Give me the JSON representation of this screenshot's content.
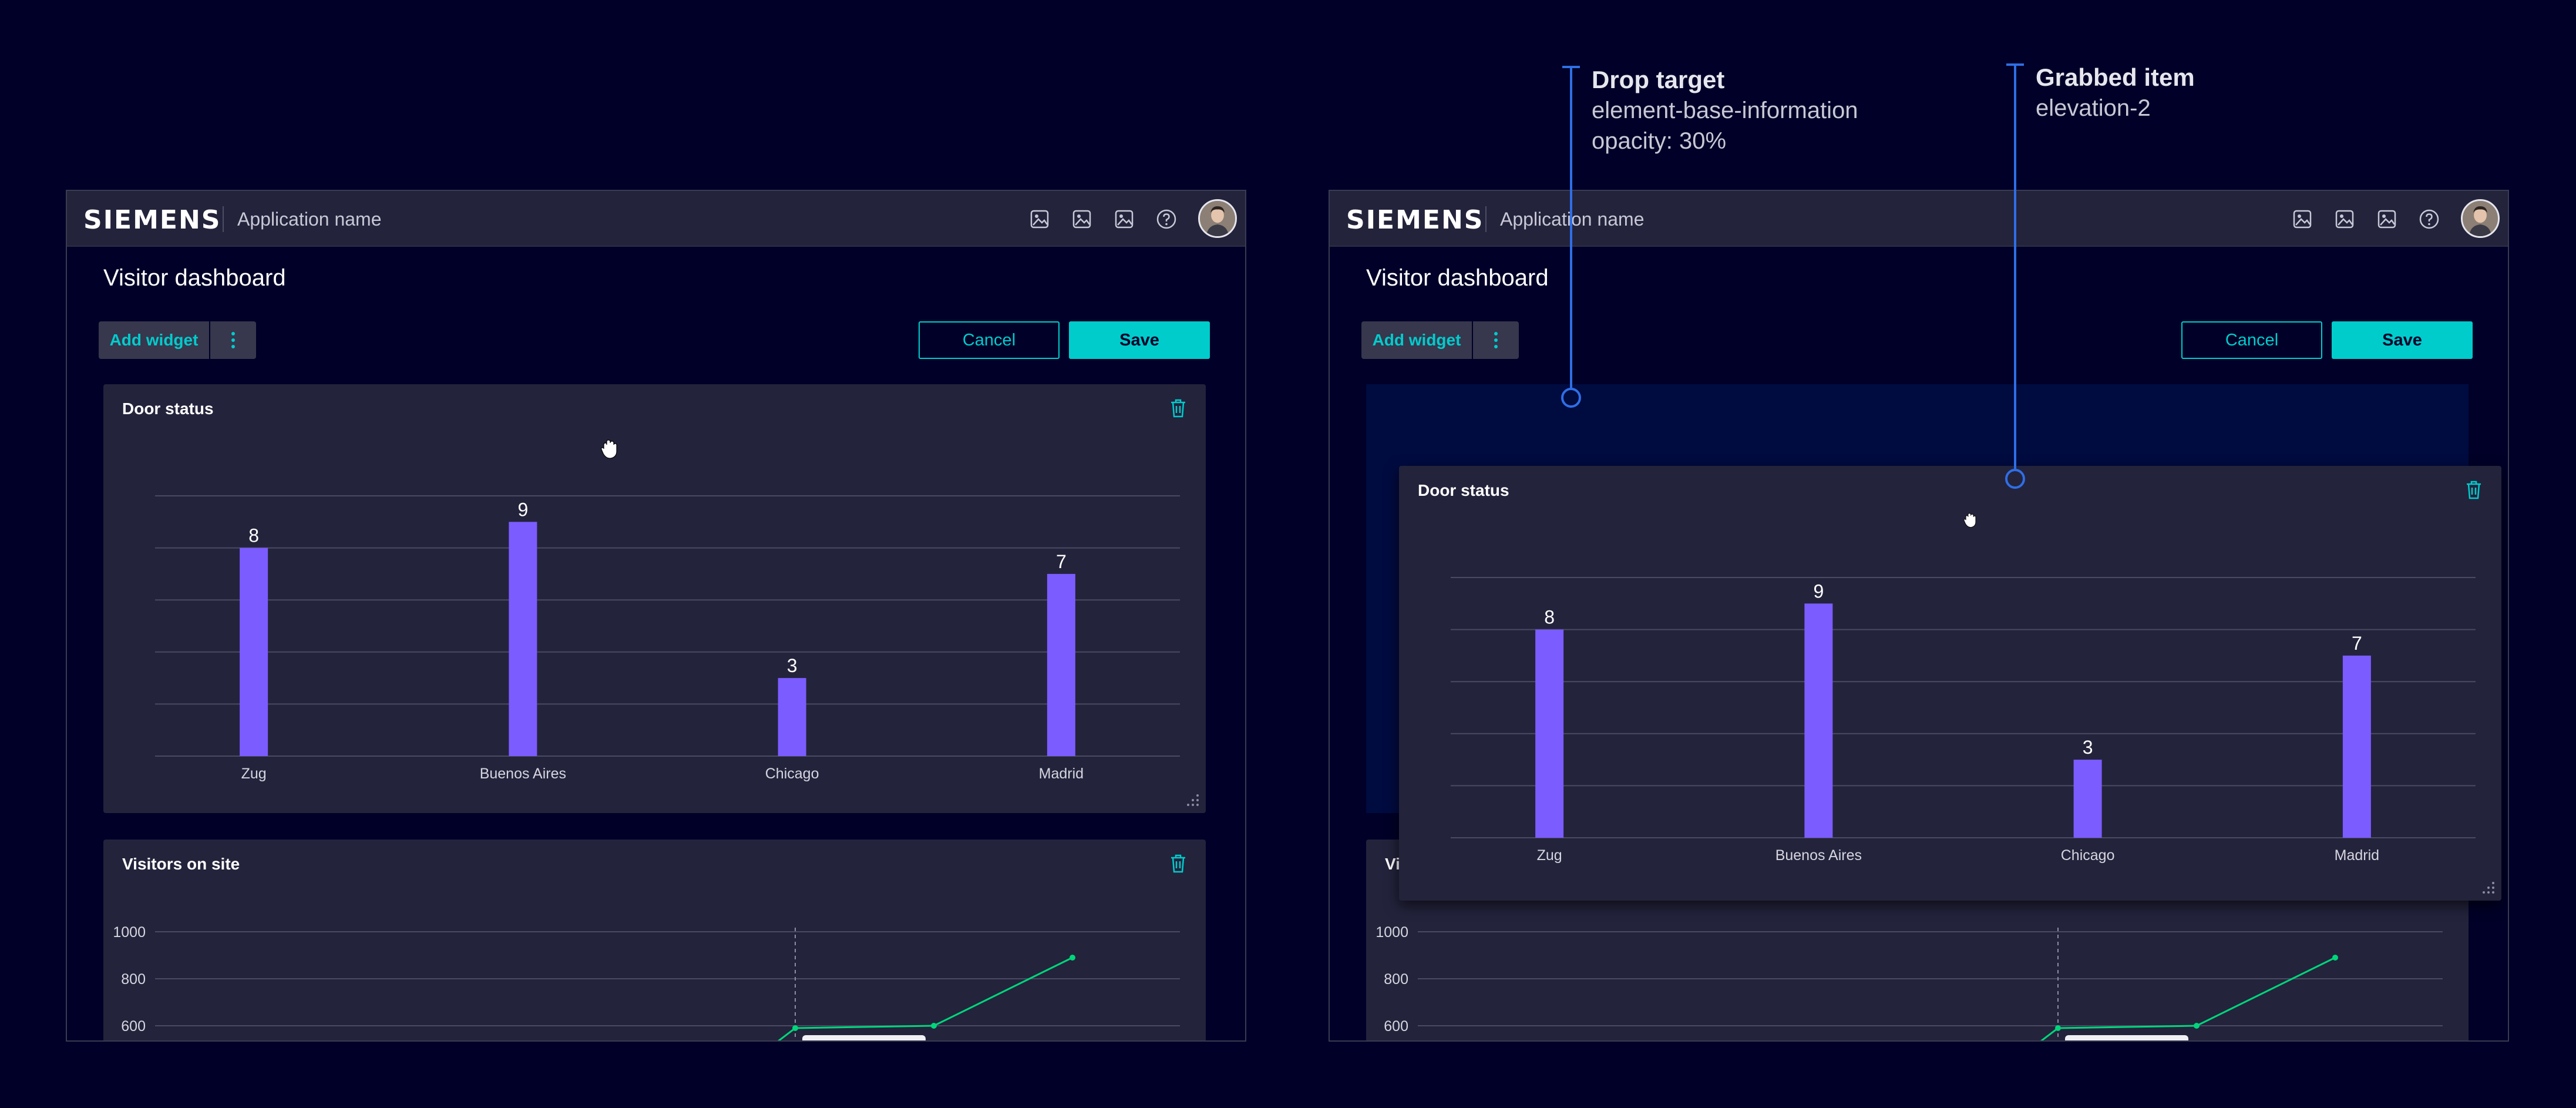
{
  "colors": {
    "background": "#000028",
    "panel": "#23233c",
    "accent": "#00cccc",
    "bar": "#7b5cff",
    "line": "#00d67a",
    "annotation_line": "#2f6ee6",
    "drop_target": "#00237a"
  },
  "annotations": {
    "drop_target": {
      "title": "Drop target",
      "line1": "element-base-information",
      "line2": "opacity: 30%"
    },
    "grabbed_item": {
      "title": "Grabbed item",
      "line1": "elevation-2"
    }
  },
  "header": {
    "logo": "SIEMENS",
    "app_name": "Application name",
    "icons": [
      "image-icon",
      "image-icon",
      "image-icon",
      "help-icon"
    ],
    "avatar": "user-avatar"
  },
  "page": {
    "title": "Visitor dashboard",
    "add_widget": "Add widget",
    "more_icon": "kebab-menu-icon",
    "cancel": "Cancel",
    "save": "Save"
  },
  "door_widget": {
    "title": "Door status",
    "delete_icon": "trash-icon",
    "cursor_icon": "grab-hand-icon",
    "resize_icon": "resize-handle-icon"
  },
  "visitors_widget": {
    "title": "Visitors on site",
    "title_truncated": "Vi",
    "delete_icon": "trash-icon"
  },
  "chart_data": [
    {
      "type": "bar",
      "title": "Door status",
      "categories": [
        "Zug",
        "Buenos Aires",
        "Chicago",
        "Madrid"
      ],
      "values": [
        8,
        9,
        3,
        7
      ],
      "data_labels": [
        "8",
        "9",
        "3",
        "7"
      ],
      "ylim": [
        0,
        10
      ],
      "grid": true
    },
    {
      "type": "line",
      "title": "Visitors on site",
      "y_tick_labels": [
        "1000",
        "800",
        "600"
      ],
      "ylim": [
        0,
        1000
      ],
      "series": [
        {
          "values": [
            {
              "x": 2.9,
              "y": 500
            },
            {
              "x": 3.0,
              "y": 590
            },
            {
              "x": 3.5,
              "y": 600
            },
            {
              "x": 4.0,
              "y": 890
            }
          ]
        }
      ],
      "marker_x": 3.0,
      "grid": true
    }
  ]
}
